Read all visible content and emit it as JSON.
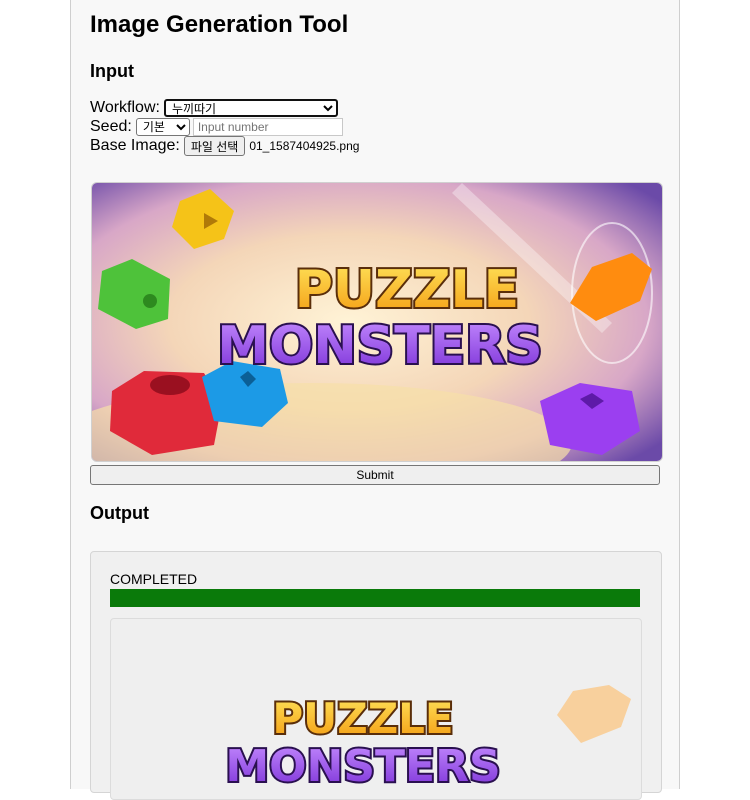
{
  "page": {
    "title": "Image Generation Tool"
  },
  "input": {
    "heading": "Input",
    "workflow_label": "Workflow:",
    "workflow_value": "누끼따기",
    "seed_label": "Seed:",
    "seed_value": "기본",
    "seed_placeholder": "Input number",
    "base_image_label": "Base Image:",
    "file_button": "파일 선택",
    "file_name": "01_1587404925.png",
    "preview_logo_line1": "PUZZLE",
    "preview_logo_line2": "MONSTERS",
    "submit_label": "Submit"
  },
  "output": {
    "heading": "Output",
    "status": "COMPLETED",
    "progress": 1.0,
    "result_logo_line1": "PUZZLE",
    "result_logo_line2": "MONSTERS"
  },
  "colors": {
    "progress": "#0a7a0a",
    "logo_yellow": "#f6c21a",
    "logo_purple": "#8a3fe0"
  }
}
